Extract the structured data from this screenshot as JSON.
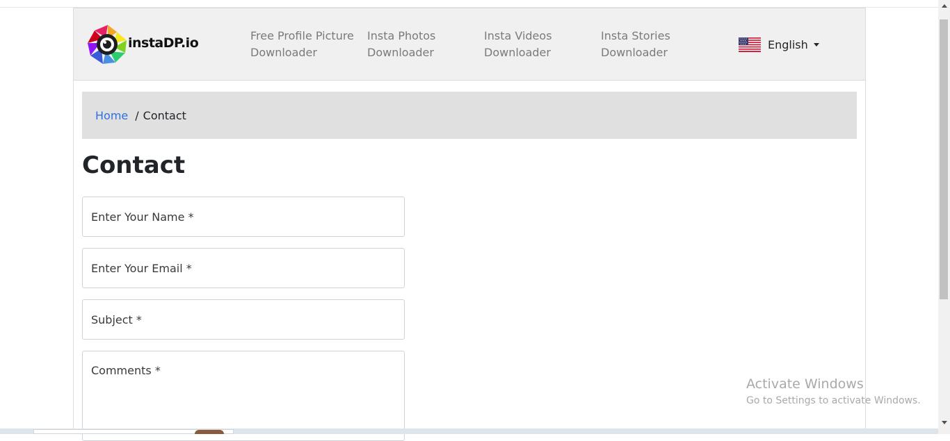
{
  "logo": {
    "text": "instaDP.io",
    "icon": "camera-aperture-logo-icon"
  },
  "nav": {
    "items": [
      {
        "line1": "Free Profile Picture",
        "line2": "Downloader"
      },
      {
        "line1": "Insta Photos",
        "line2": "Downloader"
      },
      {
        "line1": "Insta Videos",
        "line2": "Downloader"
      },
      {
        "line1": "Insta Stories",
        "line2": "Downloader"
      }
    ],
    "language": {
      "label": "English",
      "icon": "us-flag-icon"
    }
  },
  "breadcrumb": {
    "home": "Home",
    "separator": "/",
    "current": "Contact"
  },
  "page_title": "Contact",
  "form": {
    "name_placeholder": "Enter Your Name *",
    "email_placeholder": "Enter Your Email *",
    "subject_placeholder": "Subject *",
    "comments_placeholder": "Comments *"
  },
  "watermark": {
    "line1": "Activate Windows",
    "line2": "Go to Settings to activate Windows."
  },
  "colors": {
    "navbar_bg": "#f0f0f0",
    "breadcrumb_bg": "#e0e0e0",
    "link": "#2f6fe0",
    "nav_text": "#7a7a7a"
  }
}
